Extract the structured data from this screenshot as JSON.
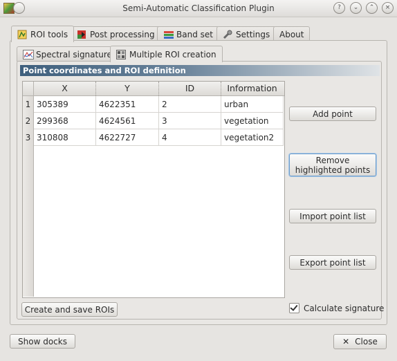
{
  "window": {
    "title": "Semi-Automatic Classification Plugin",
    "controls": [
      "?",
      "⌄",
      "⌃",
      "×"
    ]
  },
  "tabs": [
    {
      "label": "ROI tools",
      "icon": "roi-tools-icon",
      "active": true
    },
    {
      "label": "Post processing",
      "icon": "post-processing-icon",
      "active": false
    },
    {
      "label": "Band set",
      "icon": "band-set-icon",
      "active": false
    },
    {
      "label": "Settings",
      "icon": "settings-wrench-icon",
      "active": false
    },
    {
      "label": "About",
      "icon": "",
      "active": false
    }
  ],
  "subtabs": [
    {
      "label": "Spectral signature",
      "icon": "spectral-signature-icon",
      "active": false
    },
    {
      "label": "Multiple ROI creation",
      "icon": "multiple-roi-icon",
      "active": true
    }
  ],
  "group": {
    "title": "Point coordinates and ROI definition"
  },
  "table": {
    "columns": [
      "X",
      "Y",
      "ID",
      "Information"
    ],
    "rows": [
      {
        "num": "1",
        "x": "305389",
        "y": "4622351",
        "id": "2",
        "info": "urban"
      },
      {
        "num": "2",
        "x": "299368",
        "y": "4624561",
        "id": "3",
        "info": "vegetation"
      },
      {
        "num": "3",
        "x": "310808",
        "y": "4622727",
        "id": "4",
        "info": "vegetation2"
      }
    ]
  },
  "buttons": {
    "add_point": "Add point",
    "remove_line1": "Remove",
    "remove_line2": "highlighted points",
    "import_points": "Import point list",
    "export_points": "Export point list",
    "create_save": "Create and save ROIs",
    "show_docks": "Show docks",
    "close": "Close",
    "close_glyph": "✕"
  },
  "checkbox": {
    "calculate_signature": "Calculate signature",
    "checked": true
  },
  "colors": {
    "group_header": "#3e5f7d",
    "focus_border": "#6a9ccc"
  }
}
